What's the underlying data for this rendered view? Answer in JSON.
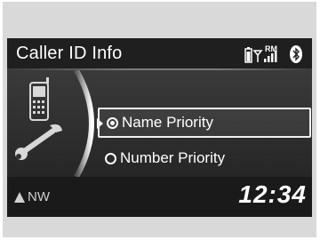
{
  "screen": {
    "title": "Caller ID Info",
    "status": {
      "roaming_label": "RM"
    },
    "menu": {
      "options": [
        {
          "label": "Name Priority",
          "selected": true
        },
        {
          "label": "Number Priority",
          "selected": false
        }
      ]
    },
    "footer": {
      "compass_heading": "NW",
      "clock": "12:34"
    }
  },
  "colors": {
    "header_bg": "#1f1f1f",
    "content_bg": "#2c2c2c",
    "text": "#ffffff"
  }
}
